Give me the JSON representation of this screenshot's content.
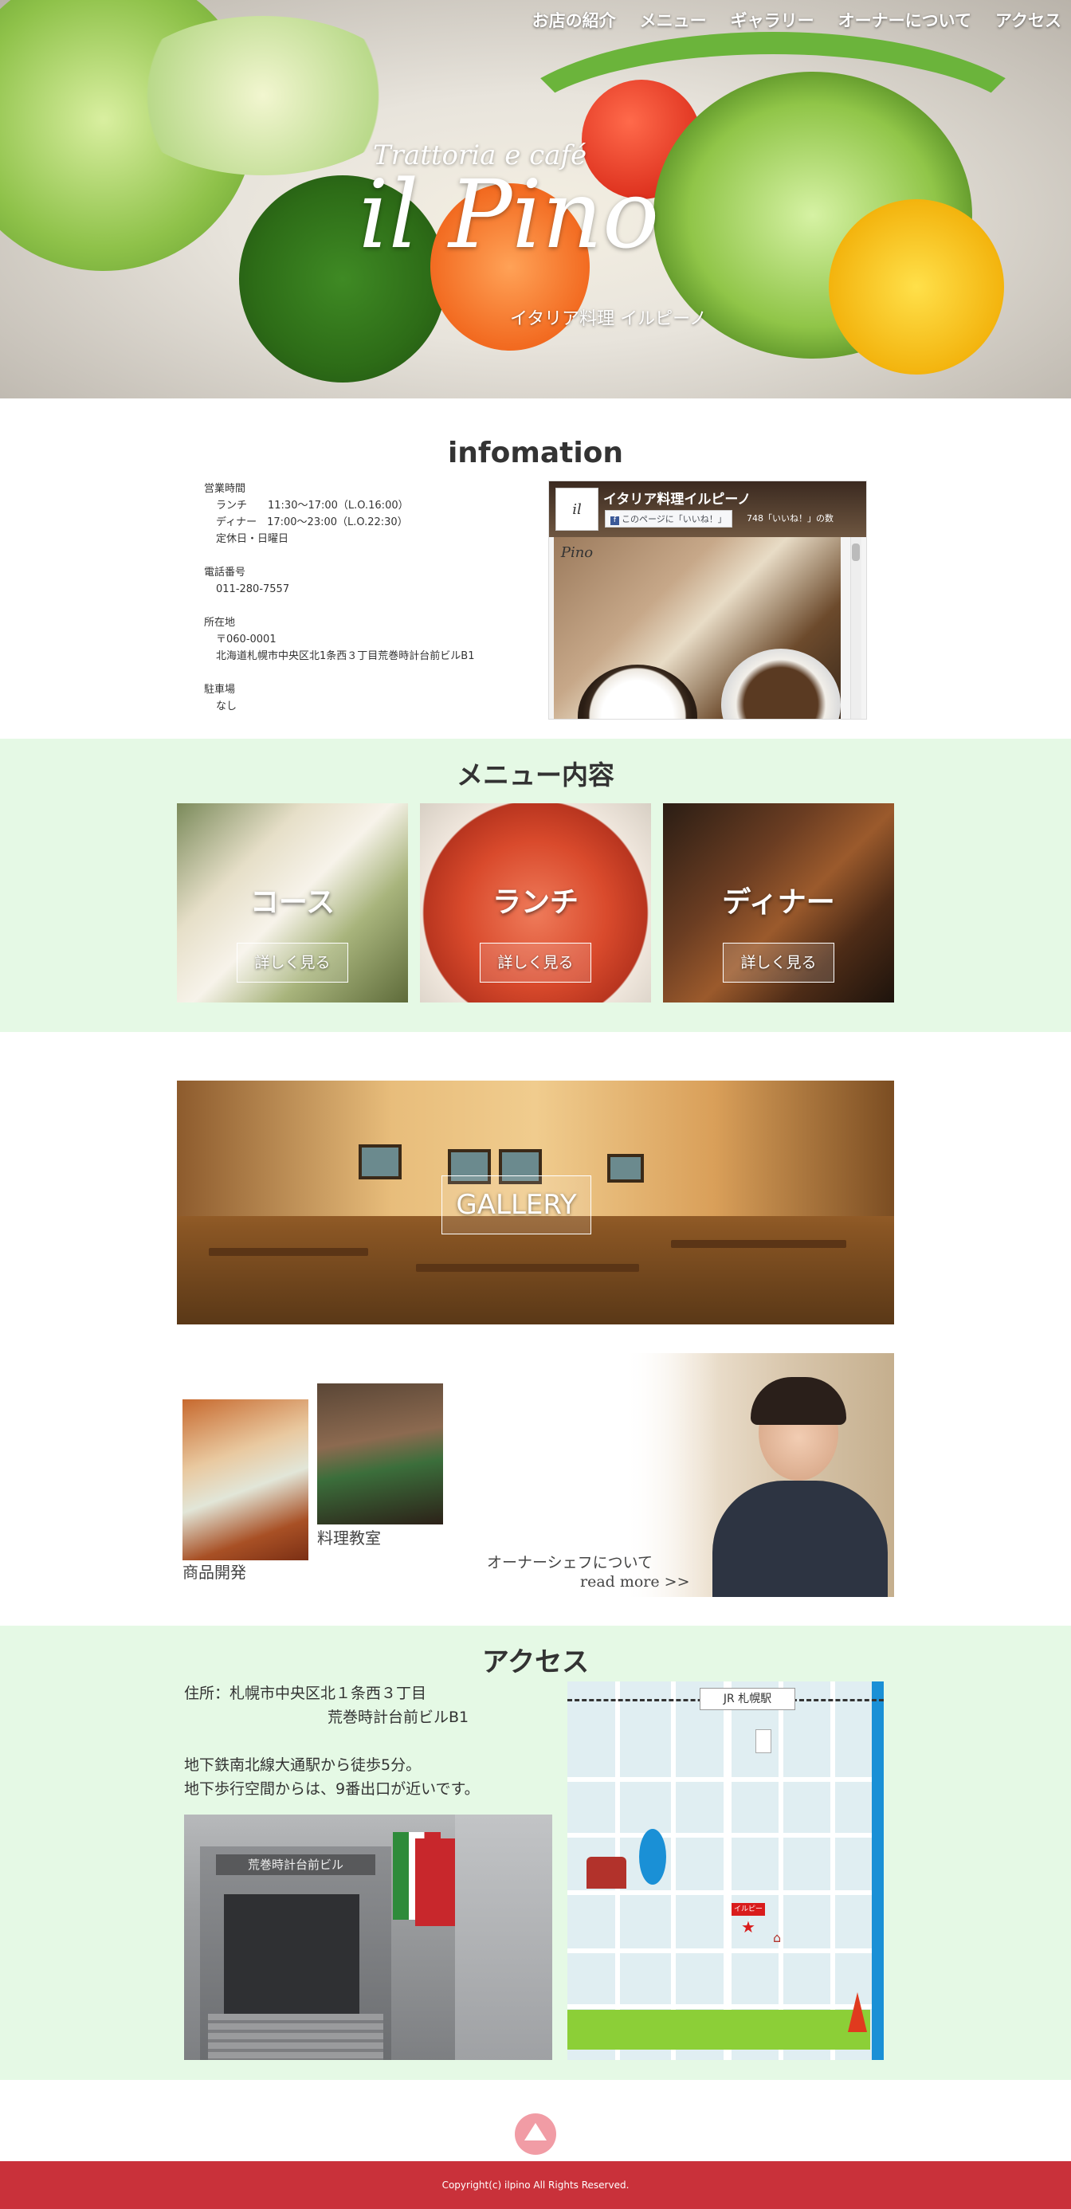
{
  "nav": {
    "items": [
      "お店の紹介",
      "メニュー",
      "ギャラリー",
      "オーナーについて",
      "アクセス"
    ]
  },
  "hero": {
    "logo_script": "Trattoria e café",
    "logo_main": "il Pino",
    "logo_sub": "イタリア料理 イルピーノ"
  },
  "info": {
    "title": "infomation",
    "hours_label": "営業時間",
    "lunch": "ランチ　　11:30～17:00（L.O.16:00）",
    "dinner": "ディナー　17:00～23:00（L.O.22:30）",
    "closed": "定休日・日曜日",
    "tel_label": "電話番号",
    "tel": "011-280-7557",
    "addr_label": "所在地",
    "zip": "〒060-0001",
    "addr": "北海道札幌市中央区北1条西３丁目荒巻時計台前ビルB1",
    "parking_label": "駐車場",
    "parking": "なし"
  },
  "facebook": {
    "page_name": "イタリア料理イルピーノ",
    "like_button": "このページに「いいね！」",
    "like_count": "748「いいね！」の数",
    "avatar_text": "il Pino"
  },
  "menu": {
    "title": "メニュー内容",
    "cards": [
      {
        "title": "コース",
        "button": "詳しく見る"
      },
      {
        "title": "ランチ",
        "button": "詳しく見る"
      },
      {
        "title": "ディナー",
        "button": "詳しく見る"
      }
    ]
  },
  "gallery": {
    "button": "GALLERY"
  },
  "extras": {
    "product_caption": "商品開発",
    "class_caption": "料理教室",
    "owner_caption": "オーナーシェフについて",
    "read_more": "read more >>"
  },
  "access": {
    "title": "アクセス",
    "line1": "住所：札幌市中央区北１条西３丁目",
    "line2": "荒巻時計台前ビルB1",
    "line3": "地下鉄南北線大通駅から徒歩5分。",
    "line4": "地下歩行空間からは、9番出口が近いです。",
    "building_sign": "荒巻時計台前ビル",
    "map_station": "JR 札幌駅",
    "map_pin": "イルピーノ"
  },
  "footer": {
    "copyright": "Copyright(c) ilpino All Rights Reserved."
  },
  "colors": {
    "menu_bg": "#e5f9e5",
    "footer_bg": "#c9313a",
    "totop": "#f19ca5"
  }
}
